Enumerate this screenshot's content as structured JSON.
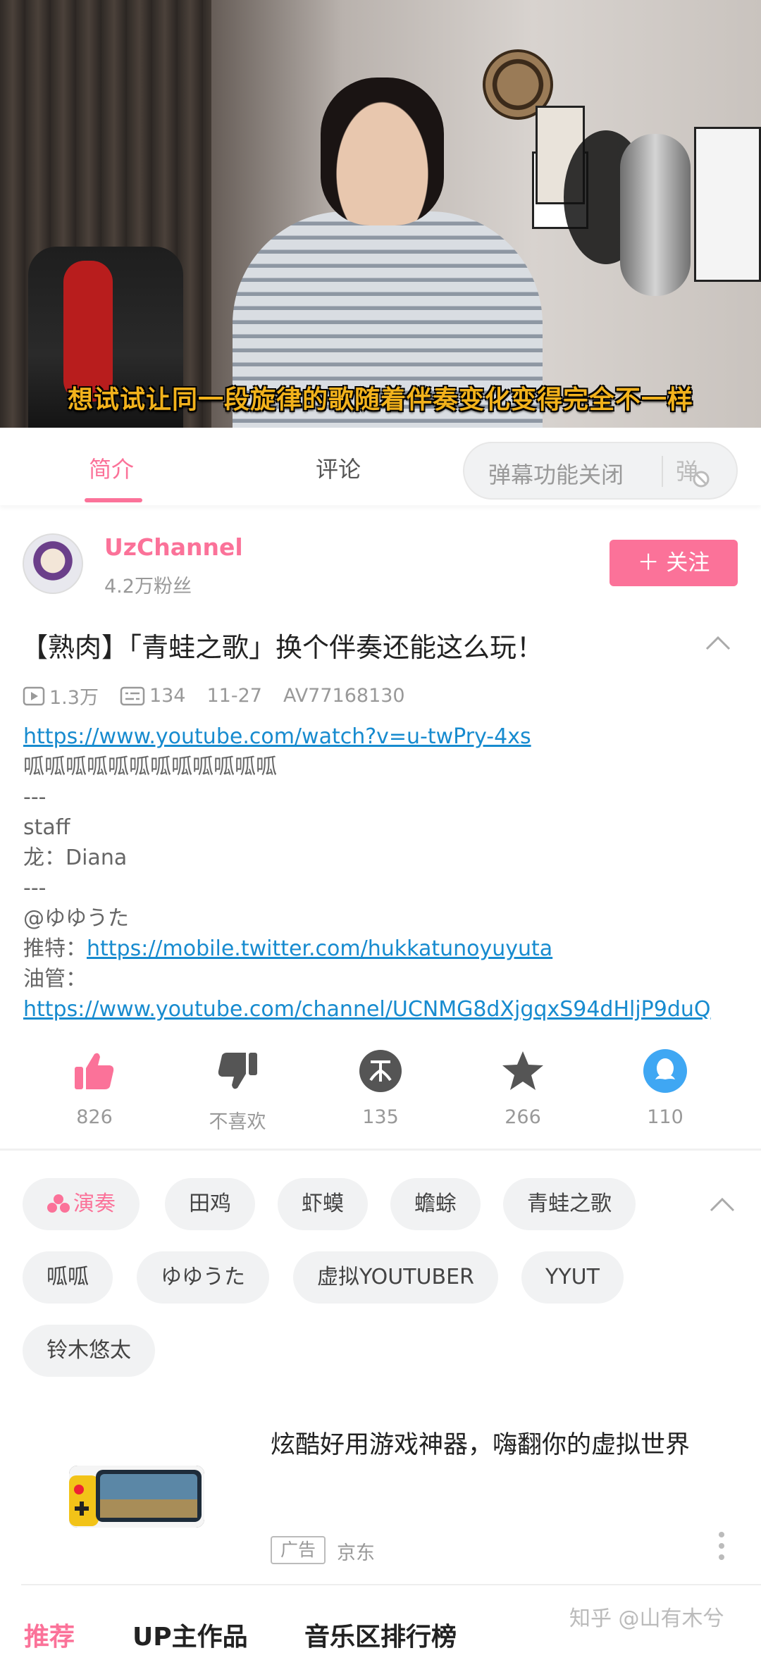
{
  "video": {
    "subtitle": "想试试让同一段旋律的歌随着伴奏变化变得完全不一样"
  },
  "tabs": {
    "intro": "简介",
    "comments": "评论",
    "danmaku_status": "弹幕功能关闭",
    "danmaku_icon": "danmaku-off-icon"
  },
  "uploader": {
    "name": "UzChannel",
    "fans": "4.2万粉丝",
    "follow_label": "＋ 关注"
  },
  "video_info": {
    "title": "【熟肉】「青蛙之歌」换个伴奏还能这么玩！",
    "views": "1.3万",
    "danmaku_count": "134",
    "date": "11-27",
    "av": "AV77168130"
  },
  "description": {
    "link1": "https://www.youtube.com/watch?v=u-twPry-4xs",
    "line2": "呱呱呱呱呱呱呱呱呱呱呱呱",
    "sep1": "---",
    "staff": "staff",
    "dragon": "龙：Diana",
    "sep2": "---",
    "handle": "@ゆゆうた",
    "twitter_label": "推特：",
    "twitter_link": "https://mobile.twitter.com/hukkatunoyuyuta",
    "youtube_label": "油管：",
    "youtube_link": "https://www.youtube.com/channel/UCNMG8dXjgqxS94dHljP9duQ"
  },
  "actions": {
    "like": "826",
    "dislike": "不喜欢",
    "coin": "135",
    "favorite": "266",
    "share": "110"
  },
  "tags": [
    "演奏",
    "田鸡",
    "虾蟆",
    "蟾蜍",
    "青蛙之歌",
    "呱呱",
    "ゆゆうた",
    "虚拟YOUTUBER",
    "YYUT",
    "铃木悠太"
  ],
  "ad": {
    "title": "炫酷好用游戏神器，嗨翻你的虚拟世界",
    "badge": "广告",
    "source": "京东"
  },
  "bottom_tabs": {
    "recommend": "推荐",
    "up_works": "UP主作品",
    "ranking": "音乐区排行榜"
  },
  "watermark": "知乎 @山有木兮",
  "colors": {
    "accent": "#fb7299",
    "link": "#178bcf",
    "subtitle": "#f2b21c"
  }
}
